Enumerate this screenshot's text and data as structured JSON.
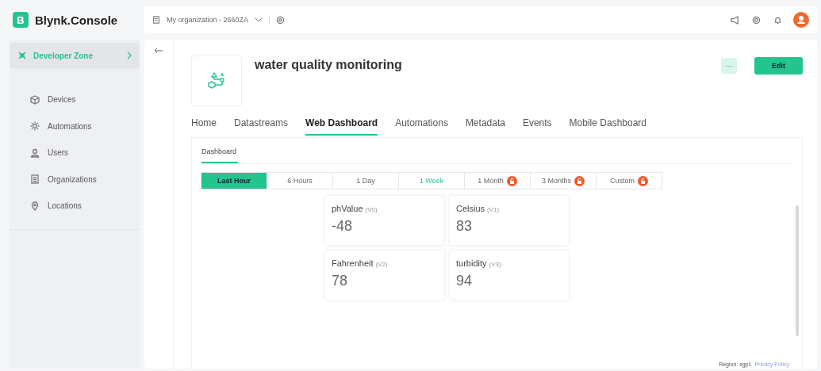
{
  "app": {
    "logo_letter": "B",
    "name": "Blynk.Console"
  },
  "top_bar": {
    "organization": "My organization - 2660ZA"
  },
  "sidebar": {
    "zone": {
      "label": "Developer Zone",
      "selected": true
    },
    "items": [
      {
        "label": "Devices",
        "kind": "devices"
      },
      {
        "label": "Automations",
        "kind": "automations"
      },
      {
        "label": "Users",
        "kind": "users"
      },
      {
        "label": "Organizations",
        "kind": "organizations"
      },
      {
        "label": "Locations",
        "kind": "locations"
      }
    ]
  },
  "template": {
    "title": "water quality monitoring",
    "more_button": "···",
    "edit_button": "Edit"
  },
  "tabs": [
    {
      "label": "Home",
      "selected": false
    },
    {
      "label": "Datastreams",
      "selected": false
    },
    {
      "label": "Web Dashboard",
      "selected": true
    },
    {
      "label": "Automations",
      "selected": false
    },
    {
      "label": "Metadata",
      "selected": false
    },
    {
      "label": "Events",
      "selected": false
    },
    {
      "label": "Mobile Dashboard",
      "selected": false
    }
  ],
  "dashboard_tabs": [
    {
      "label": "Dashboard",
      "selected": true
    }
  ],
  "time_ranges": [
    {
      "label": "Last Hour",
      "selected": true,
      "locked": false,
      "highlighted": false
    },
    {
      "label": "6 Hours",
      "selected": false,
      "locked": false,
      "highlighted": false
    },
    {
      "label": "1 Day",
      "selected": false,
      "locked": false,
      "highlighted": false
    },
    {
      "label": "1 Week",
      "selected": false,
      "locked": false,
      "highlighted": true
    },
    {
      "label": "1 Month",
      "selected": false,
      "locked": true,
      "highlighted": false
    },
    {
      "label": "3 Months",
      "selected": false,
      "locked": true,
      "highlighted": false
    },
    {
      "label": "Custom",
      "selected": false,
      "locked": true,
      "highlighted": false
    }
  ],
  "widgets": [
    {
      "name": "phValue",
      "pin": "(V0)",
      "value": "-48"
    },
    {
      "name": "Celsius",
      "pin": "(V1)",
      "value": "83"
    },
    {
      "name": "Fahrenheit",
      "pin": "(V2)",
      "value": "78"
    },
    {
      "name": "turbidity",
      "pin": "(V3)",
      "value": "94"
    }
  ],
  "footer": {
    "region": "Region: sgp1",
    "privacy_link": "Privacy Policy"
  }
}
